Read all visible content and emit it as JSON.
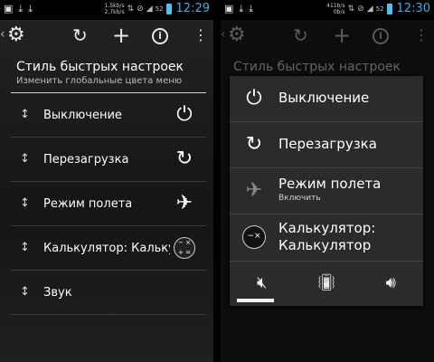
{
  "status_left": {
    "clock": "12:29",
    "speed_up": "1,5kb/s",
    "speed_down": "2,7kb/s",
    "battery": "52"
  },
  "status_right": {
    "clock": "12:30",
    "speed_up": "411b/s",
    "speed_down": "0b/s",
    "battery": "52"
  },
  "screen": {
    "title": "Стиль быстрых настроек",
    "subtitle": "Изменить глобальные цвета меню"
  },
  "items": [
    {
      "label": "Выключение",
      "icon": "power-icon"
    },
    {
      "label": "Перезагрузка",
      "icon": "reboot-icon"
    },
    {
      "label": "Режим полета",
      "icon": "airplane-icon"
    },
    {
      "label": "Калькулятор: Калькулятор",
      "icon": "calculator-icon"
    },
    {
      "label": "Звук",
      "icon": ""
    }
  ],
  "dialog": {
    "power": "Выключение",
    "reboot": "Перезагрузка",
    "airplane": "Режим полета",
    "airplane_sub": "Включить",
    "calc_line1": "Калькулятор:",
    "calc_line2": "Калькулятор"
  },
  "icons": {
    "gear": "gear-icon",
    "refresh": "refresh-icon",
    "plus": "plus-icon",
    "info": "info-icon",
    "more": "overflow-icon"
  },
  "colors": {
    "accent": "#33b5e5"
  }
}
